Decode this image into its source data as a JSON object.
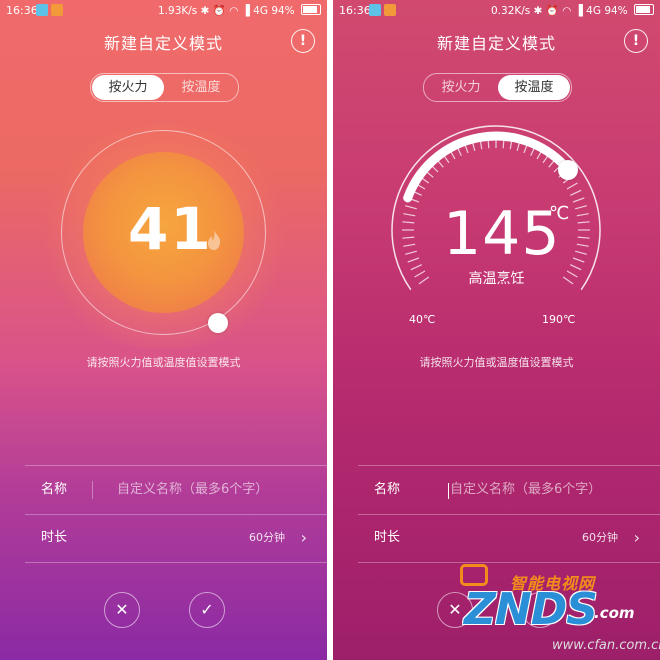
{
  "screens": [
    {
      "status": {
        "time": "16:36",
        "net_speed": "1.93K/s",
        "signal": "4G",
        "battery": "94%"
      },
      "title": "新建自定义模式",
      "tabs": [
        {
          "label": "按火力",
          "active": true
        },
        {
          "label": "按温度",
          "active": false
        }
      ],
      "dial": {
        "value": "41",
        "icon": "flame-icon"
      },
      "hint": "请按照火力值或温度值设置模式",
      "name_row": {
        "label": "名称",
        "placeholder": "自定义名称（最多6个字）"
      },
      "duration_row": {
        "label": "时长",
        "value": "60分钟"
      },
      "buttons": {
        "cancel": "✕",
        "confirm": "✓"
      }
    },
    {
      "status": {
        "time": "16:36",
        "net_speed": "0.32K/s",
        "signal": "4G",
        "battery": "94%"
      },
      "title": "新建自定义模式",
      "tabs": [
        {
          "label": "按火力",
          "active": false
        },
        {
          "label": "按温度",
          "active": true
        }
      ],
      "dial": {
        "value": "145",
        "unit": "℃",
        "mode": "高温烹饪",
        "min": "40℃",
        "max": "190℃"
      },
      "hint": "请按照火力值或温度值设置模式",
      "name_row": {
        "label": "名称",
        "placeholder": "自定义名称（最多6个字）"
      },
      "duration_row": {
        "label": "时长",
        "value": "60分钟"
      },
      "buttons": {
        "cancel": "✕",
        "confirm": "✓"
      }
    }
  ],
  "watermark": {
    "top": "智能电视网",
    "main": "ZNDS",
    "suffix": ".com",
    "site": "www.cfan.com.cn"
  }
}
